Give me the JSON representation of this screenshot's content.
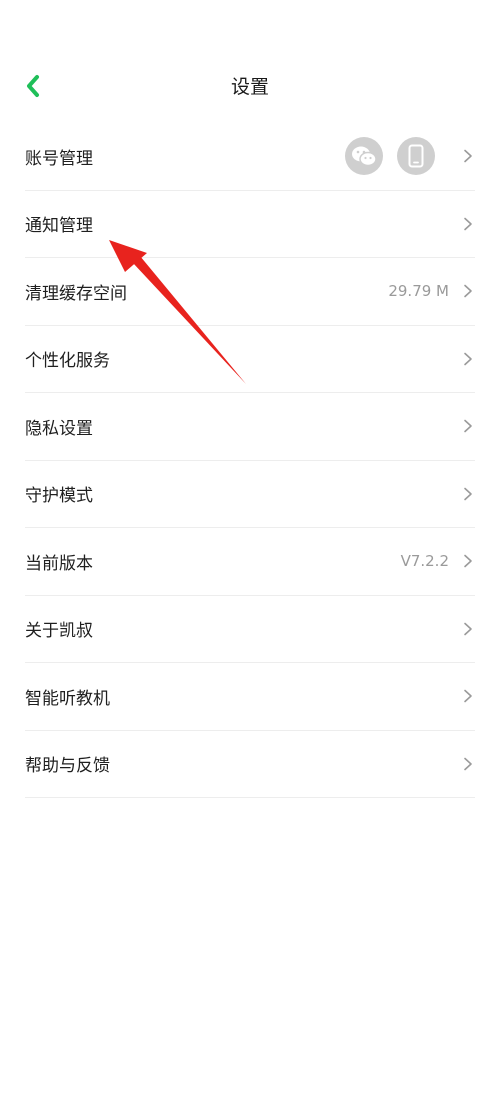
{
  "header": {
    "title": "设置",
    "back_icon": "chevron-left-icon",
    "accent_color": "#1fbf59"
  },
  "settings": [
    {
      "key": "account",
      "label": "账号管理",
      "icons": [
        "wechat-icon",
        "phone-icon"
      ]
    },
    {
      "key": "notification",
      "label": "通知管理"
    },
    {
      "key": "cache",
      "label": "清理缓存空间",
      "value": "29.79 M"
    },
    {
      "key": "personalization",
      "label": "个性化服务"
    },
    {
      "key": "privacy",
      "label": "隐私设置"
    },
    {
      "key": "guardian",
      "label": "守护模式"
    },
    {
      "key": "version",
      "label": "当前版本",
      "value": "V7.2.2"
    },
    {
      "key": "about",
      "label": "关于凯叔"
    },
    {
      "key": "device",
      "label": "智能听教机"
    },
    {
      "key": "feedback",
      "label": "帮助与反馈"
    }
  ],
  "annotation": {
    "type": "red-arrow",
    "color": "#e8231e",
    "points_to": "notification"
  }
}
